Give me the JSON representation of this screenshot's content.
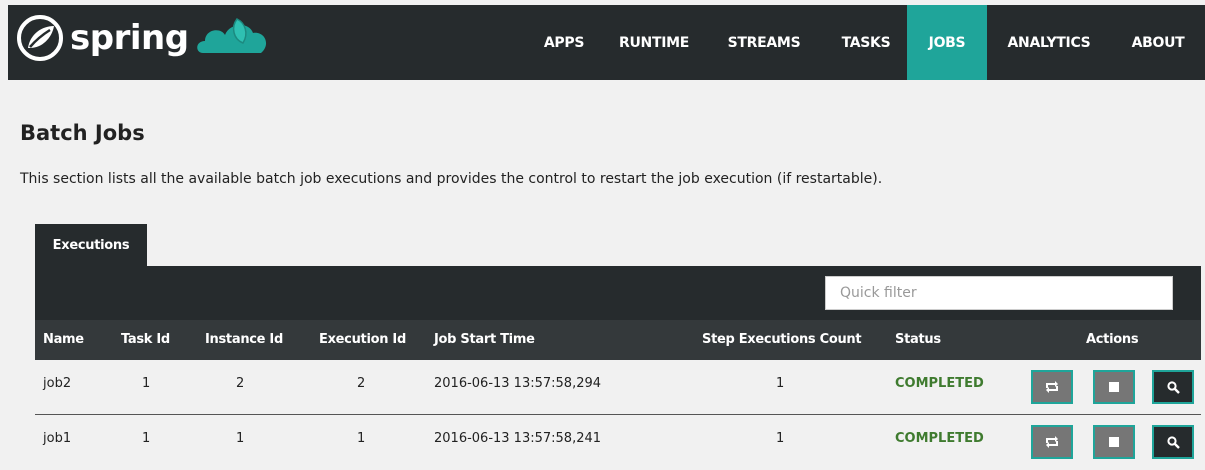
{
  "brand": {
    "name": "spring"
  },
  "nav": {
    "items": [
      {
        "label": "APPS"
      },
      {
        "label": "RUNTIME"
      },
      {
        "label": "STREAMS"
      },
      {
        "label": "TASKS"
      },
      {
        "label": "JOBS",
        "active": true
      },
      {
        "label": "ANALYTICS"
      },
      {
        "label": "ABOUT"
      }
    ]
  },
  "page": {
    "title": "Batch Jobs",
    "description": "This section lists all the available batch job executions and provides the control to restart the job execution (if restartable)."
  },
  "tabs": [
    {
      "label": "Executions",
      "active": true
    }
  ],
  "filter": {
    "placeholder": "Quick filter",
    "value": ""
  },
  "table": {
    "headers": [
      "Name",
      "Task Id",
      "Instance Id",
      "Execution Id",
      "Job Start Time",
      "Step Executions Count",
      "Status",
      "Actions"
    ],
    "rows": [
      {
        "name": "job2",
        "task_id": "1",
        "instance_id": "2",
        "execution_id": "2",
        "start_time": "2016-06-13 13:57:58,294",
        "step_count": "1",
        "status": "COMPLETED"
      },
      {
        "name": "job1",
        "task_id": "1",
        "instance_id": "1",
        "execution_id": "1",
        "start_time": "2016-06-13 13:57:58,241",
        "step_count": "1",
        "status": "COMPLETED"
      }
    ],
    "actions": [
      "restart-icon",
      "stop-icon",
      "search-icon"
    ]
  },
  "colors": {
    "nav_bg": "#262b2d",
    "accent": "#1fa59a",
    "status_ok": "#3f7b2f",
    "header_bg": "#34393b"
  }
}
